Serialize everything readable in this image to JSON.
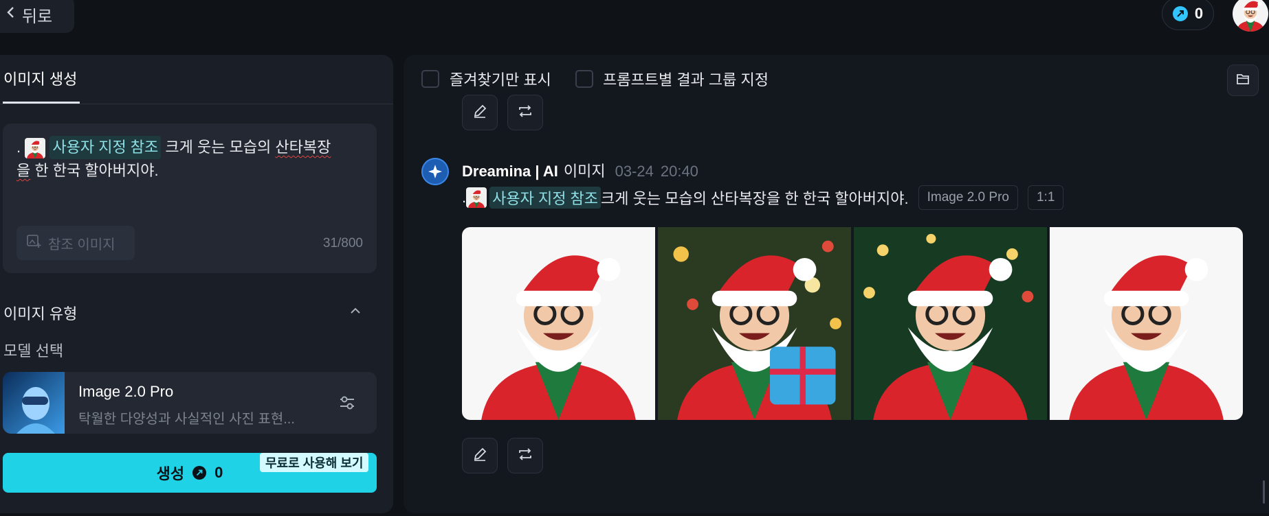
{
  "header": {
    "back_label": "뒤로",
    "credits": "0"
  },
  "left": {
    "tab": "이미지 생성",
    "prompt": {
      "prefix": ".",
      "reference_chip": "사용자 지정 참조",
      "text_part1": " 크게 웃는 모습의 ",
      "text_squiggle1": "산타복장",
      "text_squiggle2": "을",
      "text_part2": " 한 한국 할아버지야."
    },
    "reference_image_button": "참조 이미지",
    "char_count": "31/800",
    "section_image_type": "이미지 유형",
    "model_select_label": "모델 선택",
    "model": {
      "name": "Image 2.0 Pro",
      "description": "탁월한 다양성과 사실적인 사진 표현..."
    },
    "generate": {
      "label": "생성",
      "cost": "0",
      "free_badge": "무료로 사용해 보기"
    }
  },
  "right": {
    "filter_favorites": "즐겨찾기만 표시",
    "filter_group": "프롬프트별 결과 그룹 지정",
    "message": {
      "brand": "Dreamina | AI",
      "kind": "이미지",
      "date": "03-24",
      "time": "20:40",
      "prefix": ".",
      "reference_chip": "사용자 지정 참조",
      "prompt_text": "크게 웃는 모습의 산타복장을 한 한국 할아버지야.",
      "tags": [
        "Image 2.0 Pro",
        "1:1"
      ]
    }
  },
  "icons": [
    "chevron-left-icon",
    "coin-icon",
    "image-add-icon",
    "chevron-up-icon",
    "sliders-icon",
    "folder-icon",
    "edit-icon",
    "regenerate-icon",
    "dreamina-star-icon"
  ],
  "colors": {
    "accent": "#1fd2e6",
    "panel": "#1a1e26",
    "background": "#0f1217",
    "reference_chip_text": "#8ee0e6"
  }
}
